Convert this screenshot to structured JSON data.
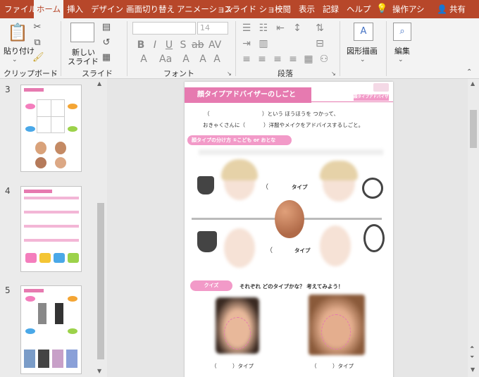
{
  "tabs": [
    "ファイル",
    "ホーム",
    "挿入",
    "デザイン",
    "画面切り替え",
    "アニメーション",
    "スライド ショー",
    "校閲",
    "表示",
    "記録",
    "ヘルプ",
    "操作アシ"
  ],
  "active_tab": "ホーム",
  "share_label": "共有",
  "ribbon": {
    "clipboard": {
      "paste_label": "貼り付け",
      "group_label": "クリップボード"
    },
    "slides": {
      "new_slide_line1": "新しい",
      "new_slide_line2": "スライド",
      "group_label": "スライド"
    },
    "font": {
      "font_size": "14",
      "group_label": "フォント"
    },
    "paragraph": {
      "group_label": "段落"
    },
    "drawing": {
      "label": "図形描画"
    },
    "editing": {
      "label": "編集"
    }
  },
  "thumbnails": [
    {
      "number": "3"
    },
    {
      "number": "4"
    },
    {
      "number": "5"
    }
  ],
  "slide": {
    "title": "顔タイプアドバイザーのしごと",
    "header_tag": "顔タイプアドバイザー",
    "line1_open": "（",
    "line1_rest": "）という ほうほうを つかって、",
    "line2_start": "おきゃくさんに（",
    "line2_rest": "）洋服やメイクをアドバイスするしごと。",
    "section_header": "顔タイプの分け方 ①こども or おとな",
    "type_top": "タイプ",
    "type_bottom": "タイプ",
    "quiz_label": "クイズ",
    "quiz_text": "それぞれ どのタイプかな？ 考えてみよう！",
    "answer_left": "（　　　）タイプ",
    "answer_right": "（　　　）タイプ"
  },
  "colors": {
    "accent": "#b7472a",
    "pink": "#e67ab0"
  }
}
